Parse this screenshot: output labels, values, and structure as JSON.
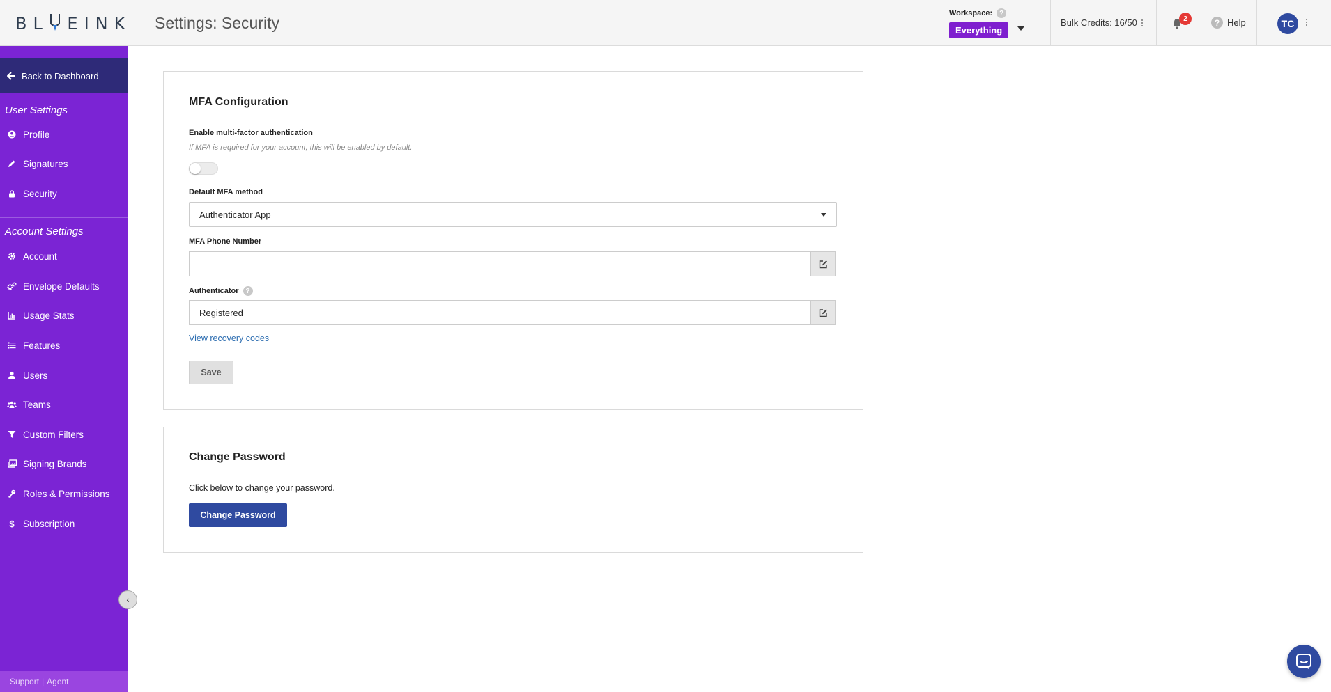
{
  "header": {
    "logo_text": "BLUEINK",
    "logo_left": "BL",
    "logo_right": "EINK",
    "title": "Settings: Security",
    "workspace_label": "Workspace:",
    "workspace_value": "Everything",
    "bulk_credits": "Bulk Credits: 16/50",
    "notification_count": "2",
    "help_label": "Help",
    "avatar_initials": "TC"
  },
  "sidebar": {
    "back_label": "Back to Dashboard",
    "user_settings_title": "User Settings",
    "user_items": [
      {
        "label": "Profile",
        "icon": "user-circle-icon"
      },
      {
        "label": "Signatures",
        "icon": "pencil-icon"
      },
      {
        "label": "Security",
        "icon": "lock-icon"
      }
    ],
    "account_settings_title": "Account Settings",
    "account_items": [
      {
        "label": "Account",
        "icon": "gear-icon"
      },
      {
        "label": "Envelope Defaults",
        "icon": "gears-icon"
      },
      {
        "label": "Usage Stats",
        "icon": "chart-icon"
      },
      {
        "label": "Features",
        "icon": "list-icon"
      },
      {
        "label": "Users",
        "icon": "user-icon"
      },
      {
        "label": "Teams",
        "icon": "users-icon"
      },
      {
        "label": "Custom Filters",
        "icon": "filter-icon"
      },
      {
        "label": "Signing Brands",
        "icon": "images-icon"
      },
      {
        "label": "Roles & Permissions",
        "icon": "key-icon"
      },
      {
        "label": "Subscription",
        "icon": "dollar-icon"
      }
    ],
    "support_label": "Support",
    "support_sep": "|",
    "agent_label": "Agent",
    "collapse_glyph": "‹"
  },
  "mfa": {
    "title": "MFA Configuration",
    "enable_label": "Enable multi-factor authentication",
    "enable_hint": "If MFA is required for your account, this will be enabled by default.",
    "enabled": false,
    "method_label": "Default MFA method",
    "method_value": "Authenticator App",
    "phone_label": "MFA Phone Number",
    "phone_value": "",
    "authenticator_label": "Authenticator",
    "authenticator_value": "Registered",
    "recovery_link": "View recovery codes",
    "save_label": "Save"
  },
  "password": {
    "title": "Change Password",
    "description": "Click below to change your password.",
    "button_label": "Change Password"
  },
  "colors": {
    "sidebar": "#7b24d4",
    "back_bar": "#2e2a78",
    "primary": "#2f4aa0",
    "workspace_badge": "#7f1fcf",
    "notification": "#e53935"
  }
}
